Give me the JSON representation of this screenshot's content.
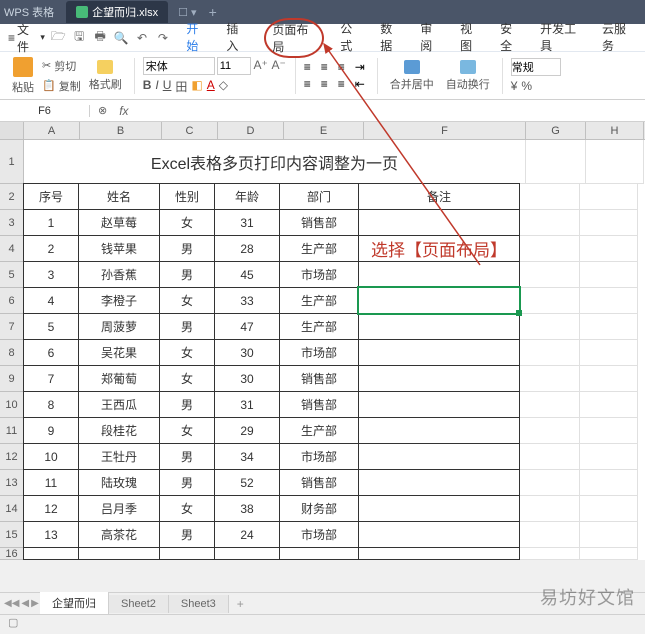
{
  "app": {
    "name": "WPS 表格",
    "doc": "企望而归.xlsx"
  },
  "menu": {
    "file": "文件",
    "tabs": [
      "开始",
      "插入",
      "页面布局",
      "公式",
      "数据",
      "审阅",
      "视图",
      "安全",
      "开发工具",
      "云服务"
    ]
  },
  "ribbon": {
    "cut": "剪切",
    "paste": "粘贴",
    "copy": "复制",
    "format_painter": "格式刷",
    "font_name": "宋体",
    "font_size": "11",
    "merge": "合并居中",
    "wrap": "自动换行",
    "style": "常规"
  },
  "formula": {
    "cell_ref": "F6",
    "fx": "fx"
  },
  "columns": [
    "A",
    "B",
    "C",
    "D",
    "E",
    "F",
    "G",
    "H"
  ],
  "big_title": "Excel表格多页打印内容调整为一页",
  "annotation": "选择【页面布局】",
  "headers": {
    "seq": "序号",
    "name": "姓名",
    "gender": "性别",
    "age": "年龄",
    "dept": "部门",
    "note": "备注"
  },
  "rows": [
    {
      "seq": "1",
      "name": "赵草莓",
      "gender": "女",
      "age": "31",
      "dept": "销售部"
    },
    {
      "seq": "2",
      "name": "钱苹果",
      "gender": "男",
      "age": "28",
      "dept": "生产部"
    },
    {
      "seq": "3",
      "name": "孙香蕉",
      "gender": "男",
      "age": "45",
      "dept": "市场部"
    },
    {
      "seq": "4",
      "name": "李橙子",
      "gender": "女",
      "age": "33",
      "dept": "生产部"
    },
    {
      "seq": "5",
      "name": "周菠萝",
      "gender": "男",
      "age": "47",
      "dept": "生产部"
    },
    {
      "seq": "6",
      "name": "吴花果",
      "gender": "女",
      "age": "30",
      "dept": "市场部"
    },
    {
      "seq": "7",
      "name": "郑葡萄",
      "gender": "女",
      "age": "30",
      "dept": "销售部"
    },
    {
      "seq": "8",
      "name": "王西瓜",
      "gender": "男",
      "age": "31",
      "dept": "销售部"
    },
    {
      "seq": "9",
      "name": "段桂花",
      "gender": "女",
      "age": "29",
      "dept": "生产部"
    },
    {
      "seq": "10",
      "name": "王牡丹",
      "gender": "男",
      "age": "34",
      "dept": "市场部"
    },
    {
      "seq": "11",
      "name": "陆玫瑰",
      "gender": "男",
      "age": "52",
      "dept": "销售部"
    },
    {
      "seq": "12",
      "name": "吕月季",
      "gender": "女",
      "age": "38",
      "dept": "财务部"
    },
    {
      "seq": "13",
      "name": "高茶花",
      "gender": "男",
      "age": "24",
      "dept": "市场部"
    }
  ],
  "sheets": [
    "企望而归",
    "Sheet2",
    "Sheet3"
  ],
  "watermark": "易坊好文馆"
}
